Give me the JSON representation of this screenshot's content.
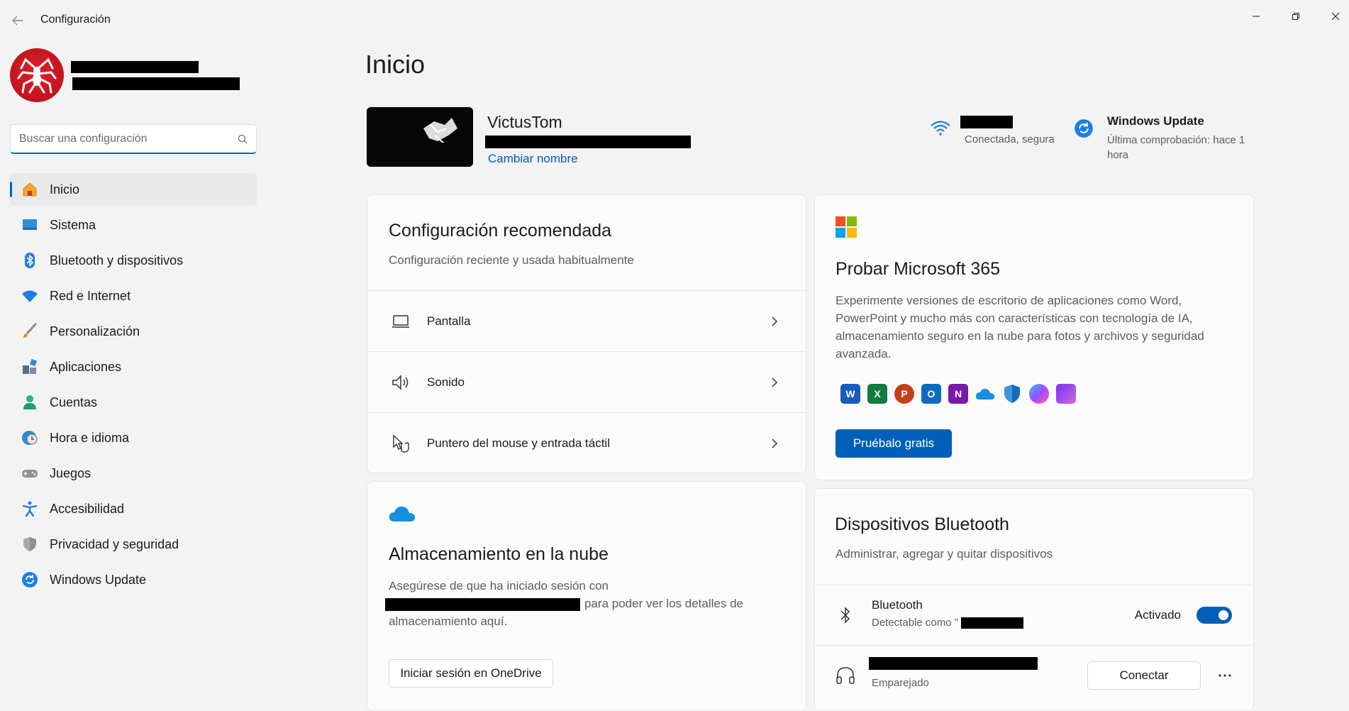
{
  "window": {
    "app_title": "Configuración",
    "back_icon": "back-arrow-icon",
    "controls": [
      "minimize-icon",
      "maximize-icon",
      "close-icon"
    ]
  },
  "search": {
    "placeholder": "Buscar una configuración",
    "value": ""
  },
  "sidebar": {
    "items": [
      {
        "label": "Inicio",
        "icon": "home-icon",
        "active": true
      },
      {
        "label": "Sistema",
        "icon": "system-icon"
      },
      {
        "label": "Bluetooth y dispositivos",
        "icon": "bluetooth-icon"
      },
      {
        "label": "Red e Internet",
        "icon": "wifi-icon"
      },
      {
        "label": "Personalización",
        "icon": "brush-icon"
      },
      {
        "label": "Aplicaciones",
        "icon": "apps-icon"
      },
      {
        "label": "Cuentas",
        "icon": "account-icon"
      },
      {
        "label": "Hora e idioma",
        "icon": "clock-globe-icon"
      },
      {
        "label": "Juegos",
        "icon": "gamepad-icon"
      },
      {
        "label": "Accesibilidad",
        "icon": "accessibility-icon"
      },
      {
        "label": "Privacidad y seguridad",
        "icon": "shield-icon"
      },
      {
        "label": "Windows Update",
        "icon": "update-icon"
      }
    ]
  },
  "main": {
    "title": "Inicio",
    "device": {
      "name": "VictusTom",
      "rename": "Cambiar nombre"
    },
    "network": {
      "status": "Conectada, segura"
    },
    "update": {
      "title": "Windows Update",
      "status": "Última comprobación: hace 1 hora"
    }
  },
  "recommended": {
    "title": "Configuración recomendada",
    "subtitle": "Configuración reciente y usada habitualmente",
    "rows": [
      {
        "label": "Pantalla",
        "icon": "display-icon"
      },
      {
        "label": "Sonido",
        "icon": "speaker-icon"
      },
      {
        "label": "Puntero del mouse y entrada táctil",
        "icon": "pointer-touch-icon"
      }
    ]
  },
  "m365": {
    "title": "Probar Microsoft 365",
    "description": "Experimente versiones de escritorio de aplicaciones como Word, PowerPoint y mucho más con características con tecnología de IA, almacenamiento seguro en la nube para fotos y archivos y seguridad avanzada.",
    "button": "Pruébalo gratis",
    "apps": [
      "word-icon",
      "excel-icon",
      "powerpoint-icon",
      "outlook-icon",
      "onenote-icon",
      "onedrive-icon",
      "defender-icon",
      "copilot-icon",
      "clipchamp-icon"
    ]
  },
  "cloud": {
    "title": "Almacenamiento en la nube",
    "text_line1": "Asegúrese de que ha iniciado sesión con",
    "text_line2": "para poder ver los detalles de",
    "text_line3": "almacenamiento aquí.",
    "button": "Iniciar sesión en OneDrive"
  },
  "bluetooth": {
    "title": "Dispositivos Bluetooth",
    "subtitle": "Administrar, agregar y quitar dispositivos",
    "bt_label": "Bluetooth",
    "bt_sub": "Detectable como \"",
    "bt_state": "Activado",
    "bt_on": true,
    "device_status": "Emparejado",
    "connect": "Conectar"
  },
  "colors": {
    "accent": "#005fb8",
    "link": "#0a58b3",
    "background": "#f3f3f3"
  }
}
